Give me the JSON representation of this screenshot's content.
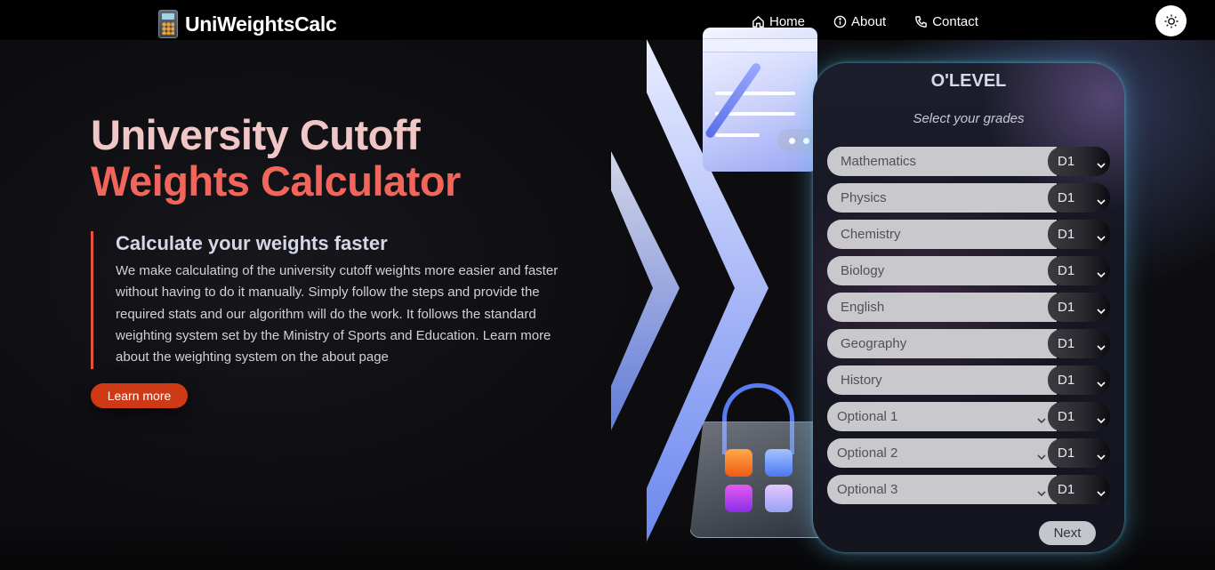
{
  "brand": {
    "icon": "calculator-icon",
    "name": "UniWeightsCalc"
  },
  "nav": {
    "items": [
      {
        "label": "Home",
        "icon": "home-icon"
      },
      {
        "label": "About",
        "icon": "info-icon"
      },
      {
        "label": "Contact",
        "icon": "phone-icon"
      }
    ],
    "theme_toggle_icon": "sun-icon"
  },
  "hero": {
    "title_line1": "University Cutoff",
    "title_line2": "Weights Calculator",
    "subheading": "Calculate your weights faster",
    "body": "We make calculating of the university cutoff weights more easier and faster without having to do it manually. Simply follow the steps and provide the required stats and our algorithm will do the work. It follows the standard weighting system set by the Ministry of Sports and Education. Learn more about the weighting system on the about page",
    "cta_label": "Learn more"
  },
  "panel": {
    "title": "O'LEVEL",
    "subtitle": "Select your grades",
    "subjects": [
      {
        "name": "Mathematics",
        "grade": "D1"
      },
      {
        "name": "Physics",
        "grade": "D1"
      },
      {
        "name": "Chemistry",
        "grade": "D1"
      },
      {
        "name": "Biology",
        "grade": "D1"
      },
      {
        "name": "English",
        "grade": "D1"
      },
      {
        "name": "Geography",
        "grade": "D1"
      },
      {
        "name": "History",
        "grade": "D1"
      },
      {
        "name": "Optional 1",
        "grade": "D1"
      },
      {
        "name": "Optional 2",
        "grade": "D1"
      },
      {
        "name": "Optional 3",
        "grade": "D1"
      }
    ],
    "next_label": "Next"
  },
  "colors": {
    "accent_red": "#f2655a",
    "cta": "#cf3a16",
    "panel_glow": "#5ac8f0"
  }
}
